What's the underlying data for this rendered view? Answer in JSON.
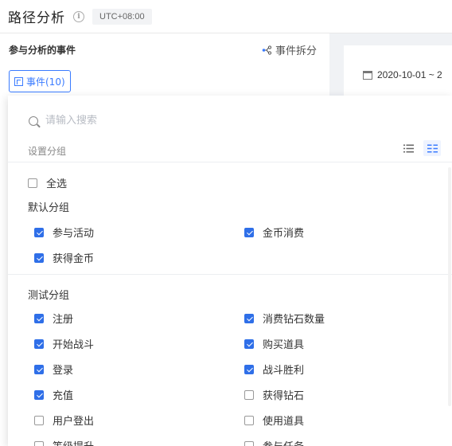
{
  "header": {
    "title": "路径分析",
    "info_icon": "info-icon",
    "timezone": "UTC+08:00"
  },
  "left_panel": {
    "heading": "参与分析的事件",
    "split_label": "事件拆分",
    "events_button": "事件(10)"
  },
  "right_card": {
    "date_range": "2020-10-01 ~ 2"
  },
  "dropdown": {
    "search_placeholder": "请输入搜索",
    "group_setting_label": "设置分组",
    "select_all": {
      "label": "全选",
      "checked": false
    },
    "groups": [
      {
        "title": "默认分组",
        "items": [
          {
            "label": "参与活动",
            "checked": true
          },
          {
            "label": "金币消费",
            "checked": true
          },
          {
            "label": "获得金币",
            "checked": true
          }
        ]
      },
      {
        "title": "测试分组",
        "items": [
          {
            "label": "注册",
            "checked": true
          },
          {
            "label": "消费钻石数量",
            "checked": true
          },
          {
            "label": "开始战斗",
            "checked": true
          },
          {
            "label": "购买道具",
            "checked": true
          },
          {
            "label": "登录",
            "checked": true
          },
          {
            "label": "战斗胜利",
            "checked": true
          },
          {
            "label": "充值",
            "checked": true
          },
          {
            "label": "获得钻石",
            "checked": false
          },
          {
            "label": "用户登出",
            "checked": false
          },
          {
            "label": "使用道具",
            "checked": false
          },
          {
            "label": "等级提升",
            "checked": false
          },
          {
            "label": "参与任务",
            "checked": false
          }
        ]
      }
    ]
  },
  "colors": {
    "accent": "#2f6fe8",
    "link": "#3a7bff"
  }
}
